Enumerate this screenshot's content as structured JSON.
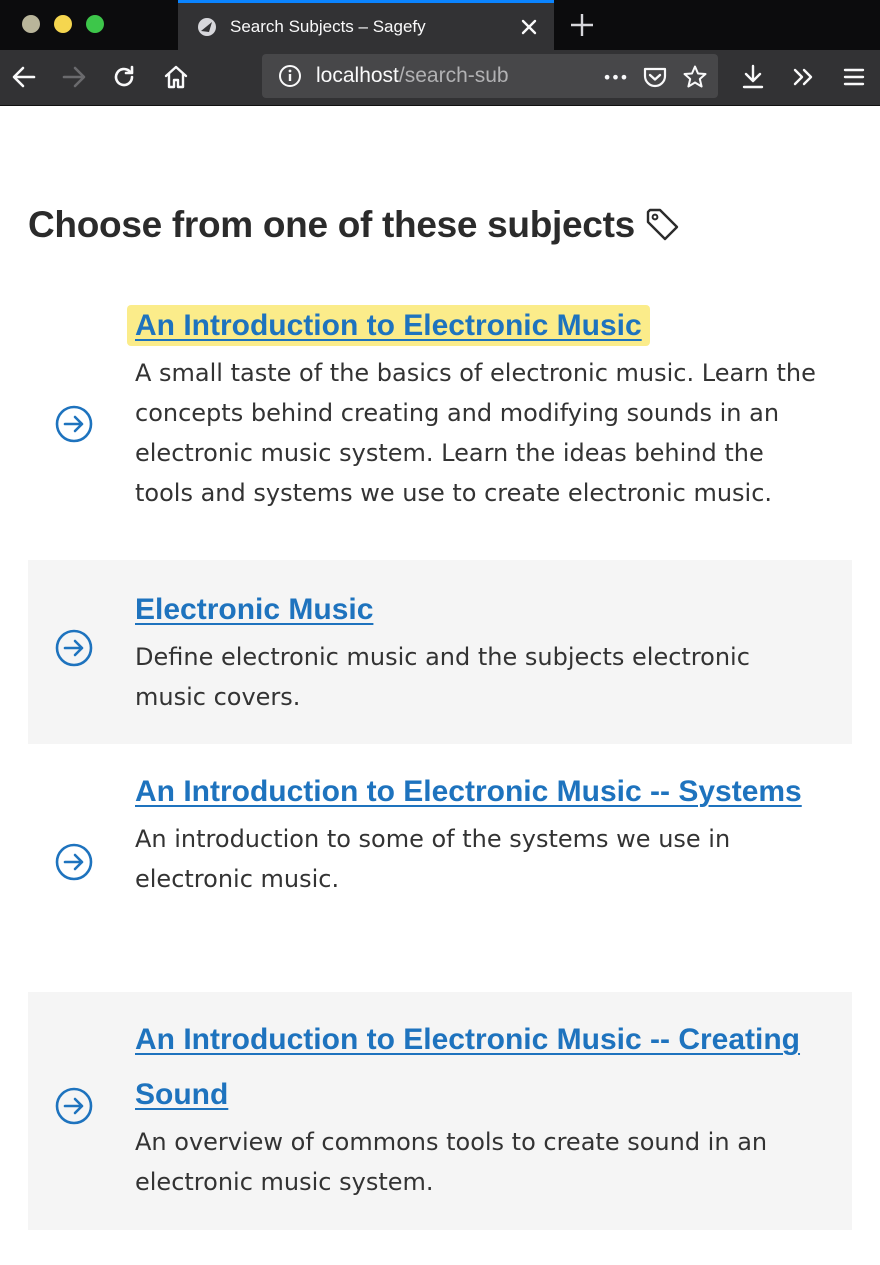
{
  "browser": {
    "tab_title": "Search Subjects – Sagefy",
    "url_host": "localhost",
    "url_path": "/search-sub",
    "url_more": "•••"
  },
  "page": {
    "heading": "Choose from one of these subjects"
  },
  "subjects": [
    {
      "title": "An Introduction to Electronic Music",
      "description": "A small taste of the basics of electronic music. Learn the concepts behind creating and modifying sounds in an electronic music system. Learn the ideas behind the tools and systems we use to create electronic music."
    },
    {
      "title": "Electronic Music",
      "description": "Define electronic music and the subjects electronic music covers."
    },
    {
      "title": "An Introduction to Electronic Music -- Systems",
      "description": "An introduction to some of the systems we use in electronic music."
    },
    {
      "title": "An Introduction to Electronic Music -- Creating Sound",
      "description": "An overview of commons tools to create sound in an electronic music system."
    }
  ],
  "colors": {
    "link": "#1e73be",
    "highlight": "#fbec8a",
    "chrome_dark": "#0c0c0d",
    "tab_accent": "#0a84ff"
  },
  "icons": [
    "tab-favicon",
    "close-icon",
    "plus-icon",
    "back-icon",
    "forward-icon",
    "reload-icon",
    "home-icon",
    "info-icon",
    "more-icon",
    "pocket-icon",
    "star-icon",
    "download-icon",
    "overflow-icon",
    "menu-icon",
    "tag-icon",
    "arrow-circle-right-icon"
  ]
}
